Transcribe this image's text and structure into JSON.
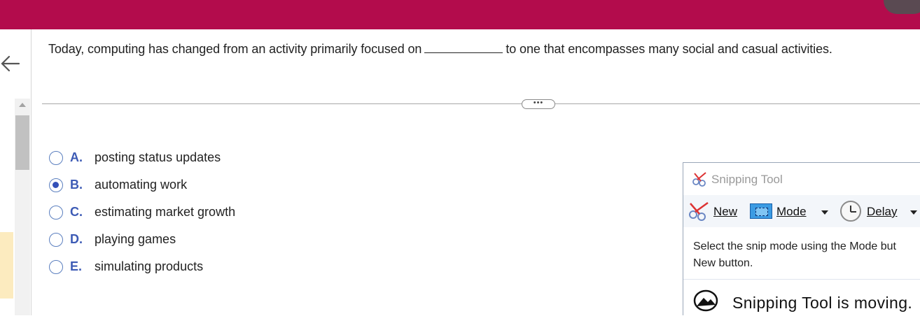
{
  "question": {
    "text_before": "Today, computing has changed from an activity primarily focused on",
    "text_after": "to one that encompasses many social and casual activities."
  },
  "divider": {
    "more_label": "•••"
  },
  "options": [
    {
      "letter": "A.",
      "text": "posting status updates",
      "selected": false
    },
    {
      "letter": "B.",
      "text": "automating work",
      "selected": true
    },
    {
      "letter": "C.",
      "text": "estimating market growth",
      "selected": false
    },
    {
      "letter": "D.",
      "text": "playing games",
      "selected": false
    },
    {
      "letter": "E.",
      "text": "simulating products",
      "selected": false
    }
  ],
  "snipping_tool": {
    "title": "Snipping Tool",
    "toolbar": {
      "new_label": "New",
      "mode_label": "Mode",
      "delay_label": "Delay"
    },
    "message_line1": "Select the snip mode using the Mode but",
    "message_line2": "New button.",
    "status": "Snipping Tool is moving."
  },
  "colors": {
    "header": "#b30c4c",
    "accent": "#3d5bb5",
    "highlight": "#fcebbf"
  },
  "icons": [
    "back-arrow-icon",
    "scissors-icon",
    "mode-rectangle-icon",
    "clock-icon",
    "snip-sketch-icon"
  ]
}
